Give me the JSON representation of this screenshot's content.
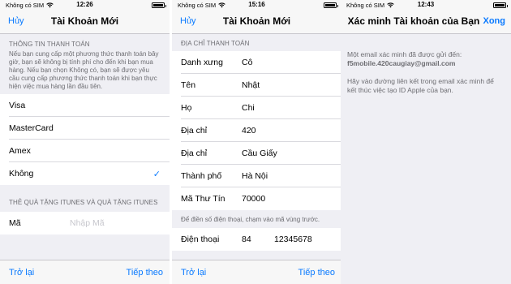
{
  "colors": {
    "accent": "#0a7aff",
    "background": "#efeff4",
    "bar": "#f7f7f7",
    "secondary_text": "#6d6d72"
  },
  "screen1": {
    "status": {
      "carrier": "Không có SIM",
      "time": "12:26"
    },
    "nav": {
      "cancel": "Hủy",
      "title": "Tài Khoản Mới"
    },
    "payment_header": "THÔNG TIN THANH TOÁN",
    "payment_desc": "Nếu bạn cung cấp một phương thức thanh toán bây giờ, bạn sẽ không bị tính phí cho đến khi bạn mua hàng. Nếu bạn chọn Không có, bạn sẽ được yêu cầu cung cấp phương thức thanh toán khi bạn thực hiện việc mua hàng lần đầu tiên.",
    "payment_options": [
      {
        "label": "Visa"
      },
      {
        "label": "MasterCard"
      },
      {
        "label": "Amex"
      },
      {
        "label": "Không",
        "check": "✓"
      }
    ],
    "gift_header": "THẺ QUÀ TẶNG ITUNES VÀ QUÀ TẶNG ITUNES",
    "code_label": "Mã",
    "code_placeholder": "Nhập Mã",
    "back": "Trở lại",
    "next": "Tiếp theo"
  },
  "screen2": {
    "status": {
      "carrier": "Không có SIM",
      "time": "15:16"
    },
    "nav": {
      "cancel": "Hủy",
      "title": "Tài Khoản Mới"
    },
    "billing_header": "ĐỊA CHỈ THANH TOÁN",
    "fields": [
      {
        "label": "Danh xưng",
        "value": "Cô"
      },
      {
        "label": "Tên",
        "value": "Nhật"
      },
      {
        "label": "Họ",
        "value": "Chi"
      },
      {
        "label": "Địa chỉ",
        "value": "420"
      },
      {
        "label": "Địa chỉ",
        "value": "Cầu Giấy"
      },
      {
        "label": "Thành phố",
        "value": "Hà Nội"
      },
      {
        "label": "Mã Thư Tín",
        "value": "70000"
      }
    ],
    "phone_note": "Để điền số điện thoại, chạm vào mã vùng trước.",
    "phone_label": "Điện thoại",
    "phone_area": "84",
    "phone_number": "12345678",
    "back": "Trở lại",
    "next": "Tiếp theo"
  },
  "screen3": {
    "status": {
      "carrier": "Không có SIM",
      "time": "12:43"
    },
    "nav": {
      "title": "Xác minh Tài khoản của Bạn",
      "done": "Xong"
    },
    "sent_text": "Một email xác minh đã được gửi đến:",
    "email": "f5mobile.420caugiay@gmail.com",
    "instructions": "Hãy vào đường liên kết trong email xác minh để kết thúc việc tạo ID Apple của bạn."
  }
}
